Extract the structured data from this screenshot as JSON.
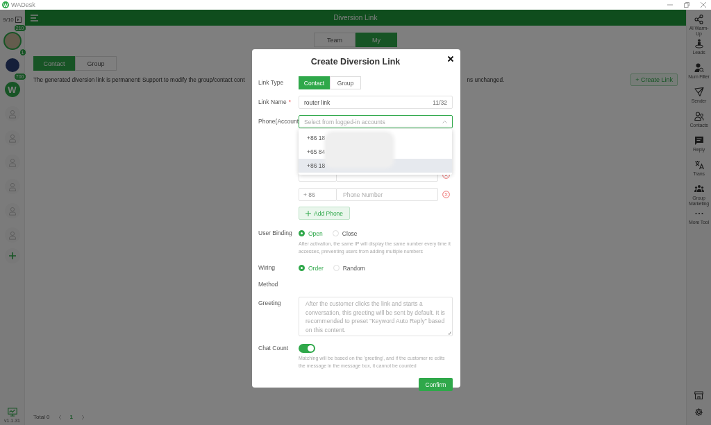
{
  "window": {
    "logo": "W",
    "title": "WADesk"
  },
  "account_bar": {
    "count": "9/10",
    "accounts": [
      {
        "kind": "photo",
        "badge": "210",
        "selected": true
      },
      {
        "kind": "photo",
        "badge": "1",
        "selected": false
      },
      {
        "kind": "logo",
        "letter": "W",
        "badge": "700",
        "selected": false
      },
      {
        "kind": "empty",
        "selected": false
      },
      {
        "kind": "empty",
        "selected": false
      },
      {
        "kind": "empty",
        "selected": false
      },
      {
        "kind": "empty",
        "selected": false
      },
      {
        "kind": "empty",
        "selected": false
      },
      {
        "kind": "empty",
        "selected": false
      }
    ],
    "version": "v1.1.31"
  },
  "header": {
    "title": "Diversion Link"
  },
  "scope_tabs": [
    {
      "label": "Team",
      "selected": false
    },
    {
      "label": "My",
      "selected": true
    }
  ],
  "type_tabs": [
    {
      "label": "Contact",
      "selected": true
    },
    {
      "label": "Group",
      "selected": false
    }
  ],
  "notice_parts": [
    "The generated diversion link is permanent! Support to modify the group/contact cont",
    "ns unchanged."
  ],
  "create_button": "+ Create Link",
  "pagination": {
    "total": "Total 0",
    "page": "1"
  },
  "tools": [
    {
      "kind": "share",
      "label": "AI Warm-Up"
    },
    {
      "kind": "leads",
      "label": "Leads"
    },
    {
      "kind": "filter",
      "label": "Num Filter"
    },
    {
      "kind": "send",
      "label": "Sender"
    },
    {
      "kind": "contacts",
      "label": "Contacts"
    },
    {
      "kind": "reply",
      "label": "Reply"
    },
    {
      "kind": "translate",
      "label": "Trans"
    },
    {
      "kind": "group",
      "label": "Group Marketing"
    },
    {
      "kind": "more",
      "label": "More Tool"
    }
  ],
  "dialog": {
    "title": "Create Diversion Link",
    "link_type": {
      "label": "Link Type",
      "options": [
        {
          "label": "Contact",
          "selected": true
        },
        {
          "label": "Group",
          "selected": false
        }
      ]
    },
    "link_name": {
      "label": "Link Name",
      "required_mark": "*",
      "value": "router link",
      "counter": "11/32"
    },
    "phone": {
      "label": "Phone(Account",
      "placeholder": "Select from logged-in accounts",
      "expanded": true,
      "options": [
        {
          "prefix": "+86 18",
          "highlighted": false
        },
        {
          "prefix": "+65 84",
          "highlighted": false
        },
        {
          "prefix": "+86 18",
          "highlighted": true
        }
      ]
    },
    "phone_rows": [
      {},
      {
        "code": "+ 86",
        "placeholder": "Phone Number"
      }
    ],
    "add_phone": "Add Phone",
    "user_binding": {
      "label": "User Binding",
      "options": [
        {
          "label": "Open",
          "selected": true
        },
        {
          "label": "Close",
          "selected": false
        }
      ],
      "hint": "After activation, the same IP will display the same number every time it accesses, preventing users from adding multiple numbers"
    },
    "wiring": {
      "label": "Wiring Method",
      "options": [
        {
          "label": "Order",
          "selected": true
        },
        {
          "label": "Random",
          "selected": false
        }
      ]
    },
    "greeting": {
      "label": "Greeting",
      "placeholder": "After the customer clicks the link and starts a conversation, this greeting will be sent by default. It is recommended to preset \"Keyword Auto Reply\" based on this content."
    },
    "chat_count": {
      "label": "Chat Count",
      "on": true,
      "hint": "Matching will be based on the 'greeting', and if the customer re edits the message in the message box, it cannot be counted"
    },
    "confirm": "Confirm"
  }
}
